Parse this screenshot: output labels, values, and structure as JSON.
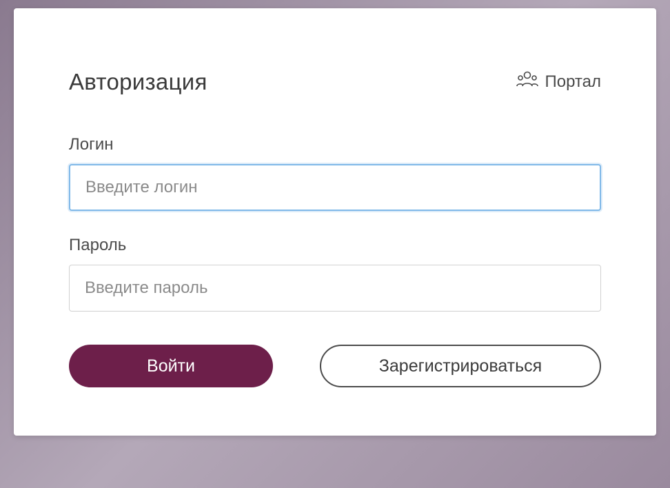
{
  "header": {
    "title": "Авторизация",
    "portal_label": "Портал"
  },
  "form": {
    "login": {
      "label": "Логин",
      "placeholder": "Введите логин",
      "value": ""
    },
    "password": {
      "label": "Пароль",
      "placeholder": "Введите пароль",
      "value": ""
    }
  },
  "buttons": {
    "submit": "Войти",
    "register": "Зарегистрироваться"
  },
  "colors": {
    "primary": "#6d1f4a",
    "focus_border": "#7fb8e8"
  }
}
